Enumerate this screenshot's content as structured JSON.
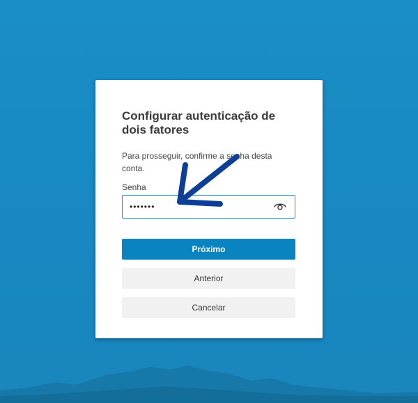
{
  "dialog": {
    "title": "Configurar autenticação de dois fatores",
    "subtitle": "Para prosseguir, confirme a senha desta conta.",
    "password_label": "Senha",
    "password_value": "•••••••",
    "show_password_icon": "eye-icon"
  },
  "buttons": {
    "next": "Próximo",
    "back": "Anterior",
    "cancel": "Cancelar"
  },
  "colors": {
    "background": "#1a8ec6",
    "primary": "#0a84c1",
    "arrow": "#0d3f96"
  }
}
